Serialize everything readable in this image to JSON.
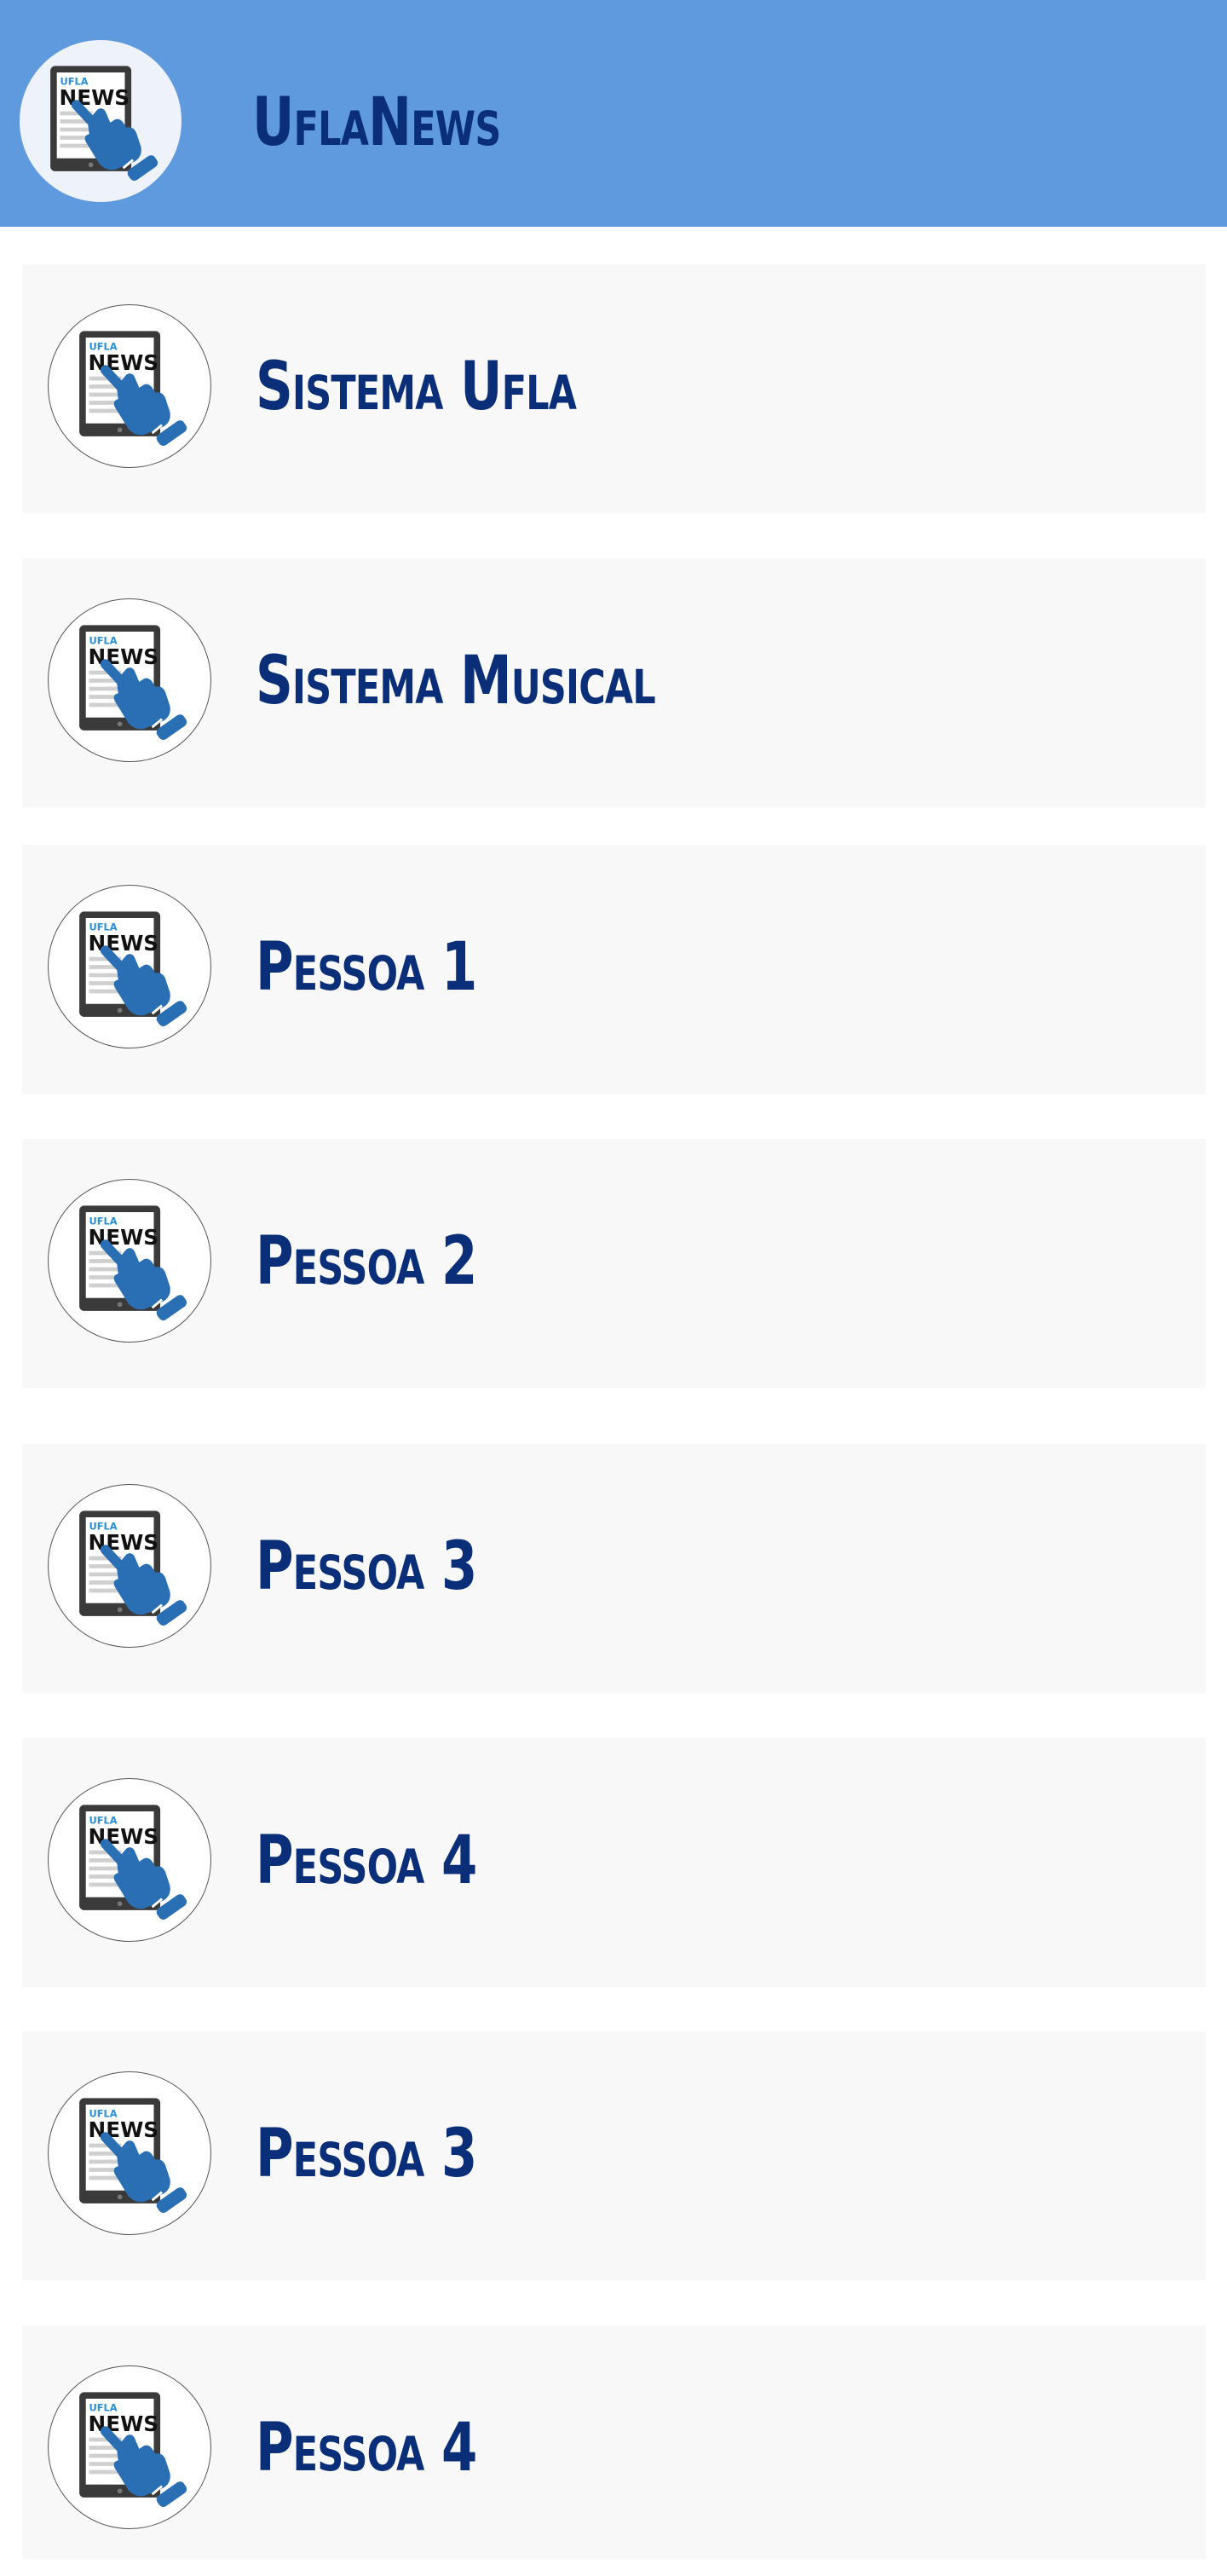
{
  "app": {
    "title": "UflaNews"
  },
  "logo": {
    "small_text": "UFLA",
    "big_text": "NEWS",
    "icon": "tablet-news-hand-icon"
  },
  "colors": {
    "header_bg": "#5f9ade",
    "title_text": "#0a2f78",
    "card_bg": "#f8f8f8",
    "hand_blue": "#2a6fb4"
  },
  "items": [
    {
      "label": "Sistema Ufla"
    },
    {
      "label": "Sistema Musical"
    },
    {
      "label": "Pessoa 1"
    },
    {
      "label": "Pessoa 2"
    },
    {
      "label": "Pessoa 3"
    },
    {
      "label": "Pessoa 4"
    },
    {
      "label": "Pessoa 3"
    },
    {
      "label": "Pessoa 4"
    }
  ]
}
